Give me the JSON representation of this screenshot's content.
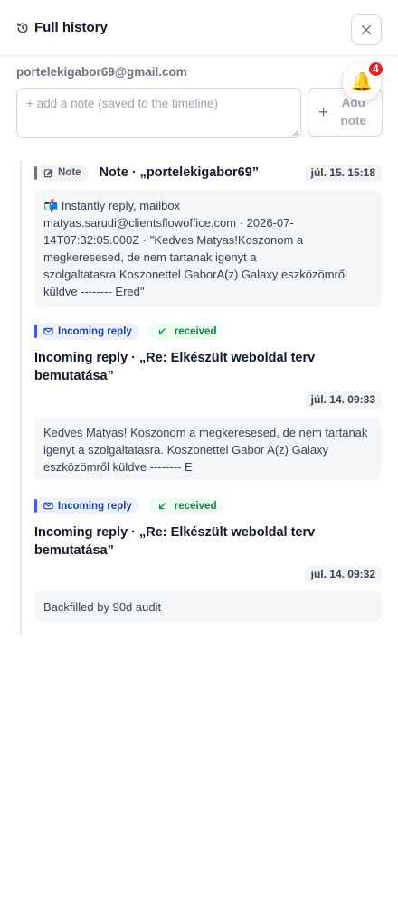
{
  "header": {
    "title": "Full history"
  },
  "contact": {
    "email": "portelekigabor69@gmail.com"
  },
  "note_input": {
    "placeholder": "+ add a note (saved to the timeline)"
  },
  "add_button": {
    "label": "Add note"
  },
  "notifications": {
    "count": "4"
  },
  "entries": [
    {
      "type_label": "Note",
      "title": "Note · „portelekigabor69”",
      "timestamp": "júl. 15. 15:18",
      "body": "📬 Instantly reply, mailbox matyas.sarudi@clientsflowoffice.com · 2026-07-14T07:32:05.000Z · \"Kedves Matyas!Koszonom a megkeresesed, de nem tartanak igenyt a szolgaltatasra.Koszonettel GaborA(z) Galaxy eszközömről küldve -------- Ered\""
    },
    {
      "type_label": "Incoming reply",
      "status_label": "received",
      "title": "Incoming reply · „Re: Elkészült weboldal terv bemutatása”",
      "timestamp": "júl. 14. 09:33",
      "body": "Kedves Matyas! Koszonom a megkeresesed, de nem tartanak igenyt a szolgaltatasra. Koszonettel Gabor A(z) Galaxy eszközömről küldve -------- E"
    },
    {
      "type_label": "Incoming reply",
      "status_label": "received",
      "title": "Incoming reply · „Re: Elkészült weboldal terv bemutatása”",
      "timestamp": "júl. 14. 09:32",
      "body": "Backfilled by 90d audit"
    }
  ],
  "colors": {
    "accent_blue": "#3b5bdb",
    "received_green": "#15803d",
    "badge_red": "#dc2626"
  }
}
